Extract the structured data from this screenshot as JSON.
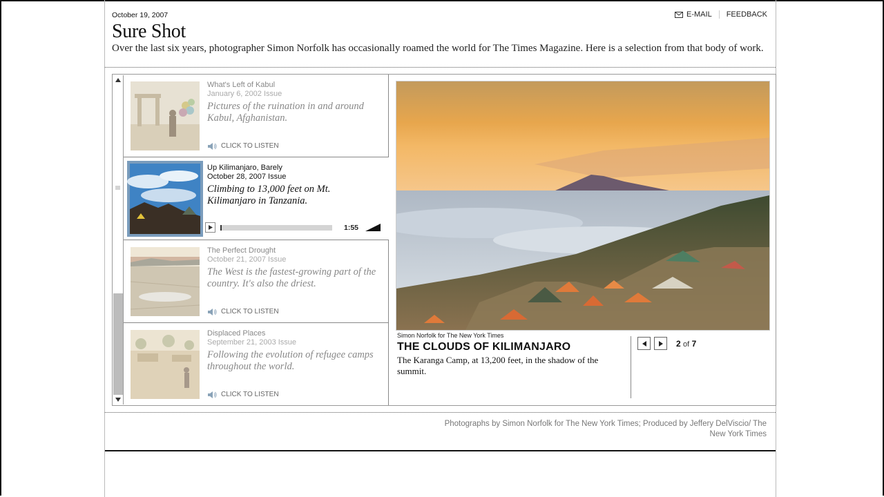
{
  "header": {
    "date": "October 19, 2007",
    "email_label": "E-MAIL",
    "feedback_label": "FEEDBACK",
    "title": "Sure Shot",
    "dek": "Over the last six years, photographer Simon Norfolk has occasionally roamed the world for The Times Magazine. Here is a selection from that body of work."
  },
  "list": [
    {
      "title": "What's Left of Kabul",
      "issue": "January 6, 2002 Issue",
      "desc": "Pictures of the ruination in and around Kabul, Afghanistan.",
      "listen": "CLICK TO LISTEN"
    },
    {
      "title": "Up Kilimanjaro, Barely",
      "issue": "October 28, 2007 Issue",
      "desc": "Climbing to 13,000 feet on Mt. Kilimanjaro in Tanzania.",
      "duration": "1:55",
      "selected": true
    },
    {
      "title": "The Perfect Drought",
      "issue": "October 21, 2007 Issue",
      "desc": "The West is the fastest-growing part of the country. It's also the driest.",
      "listen": "CLICK TO LISTEN"
    },
    {
      "title": "Displaced Places",
      "issue": "September 21, 2003 Issue",
      "desc": "Following the evolution of refugee camps throughout the world.",
      "listen": "CLICK TO LISTEN"
    }
  ],
  "photo": {
    "credit": "Simon Norfolk for The New York Times",
    "headline": "THE CLOUDS OF KILIMANJARO",
    "caption": "The Karanga Camp, at 13,200 feet, in the shadow of the summit.",
    "current": "2",
    "of_label": "of",
    "total": "7"
  },
  "footer": {
    "credits": "Photographs by Simon Norfolk for The New York Times; Produced by Jeffery DelViscio/ The New York Times"
  },
  "colors": {
    "selected_thumb_frame": "#7a9cbc",
    "scroll_track": "#bcbcbc"
  }
}
